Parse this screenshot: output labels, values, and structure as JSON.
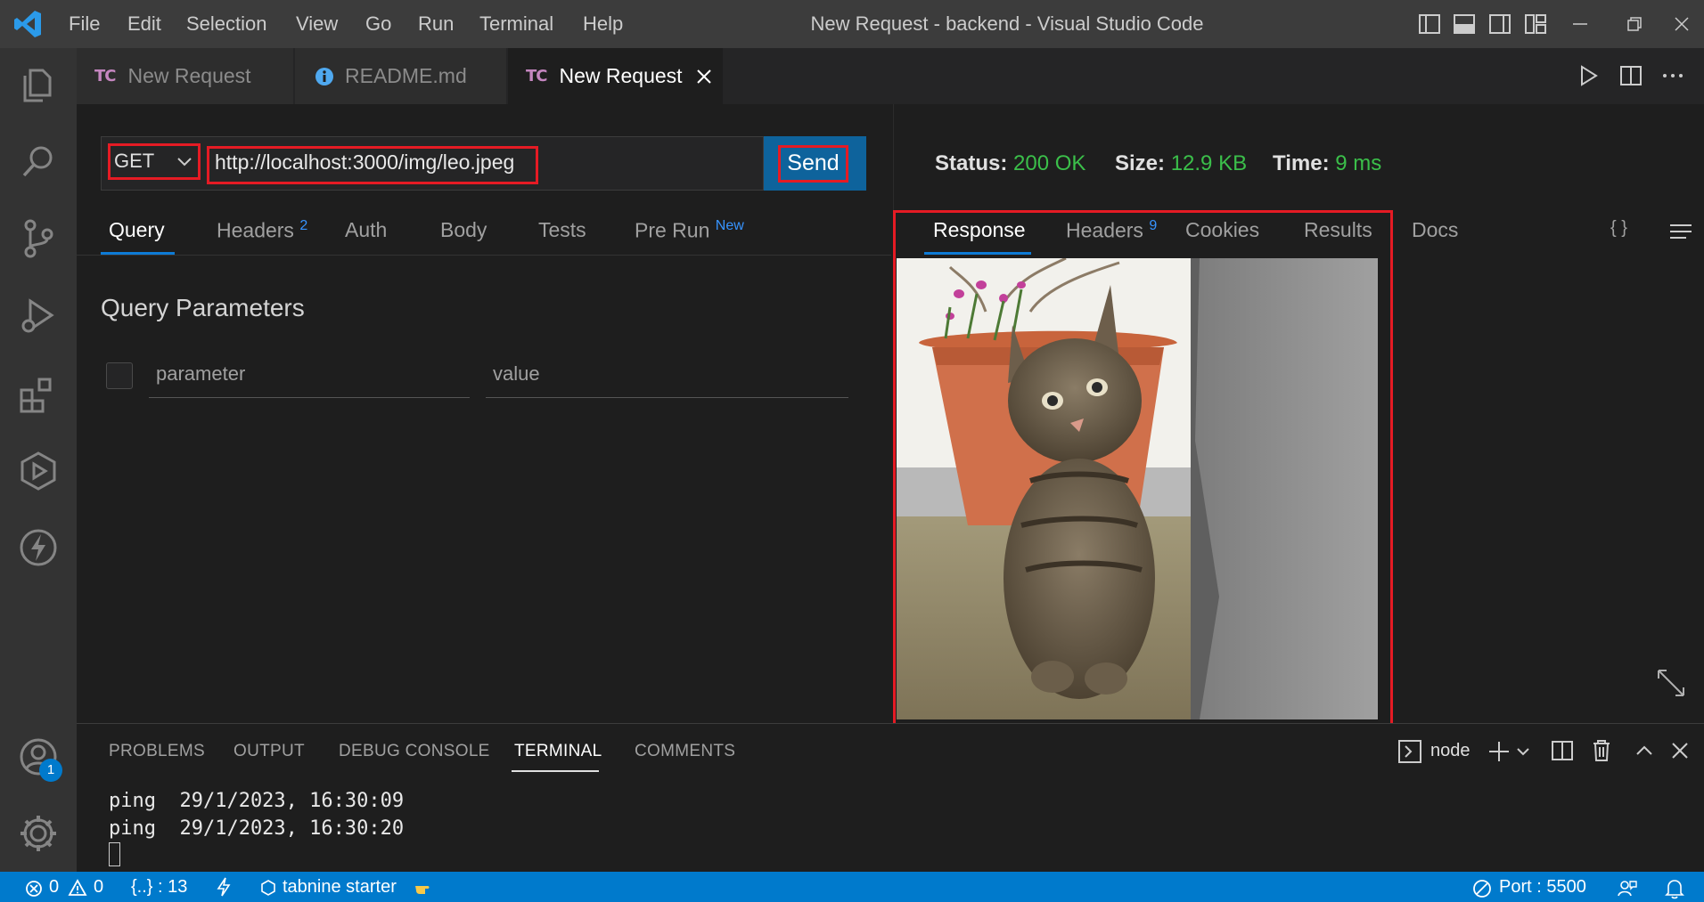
{
  "window": {
    "title": "New Request - backend - Visual Studio Code",
    "menu": [
      "File",
      "Edit",
      "Selection",
      "View",
      "Go",
      "Run",
      "Terminal",
      "Help"
    ]
  },
  "tabs": [
    {
      "badge": "TC",
      "label": "New Request",
      "active": false
    },
    {
      "badge": "",
      "label": "README.md",
      "active": false,
      "icon": "info-icon"
    },
    {
      "badge": "TC",
      "label": "New Request",
      "active": true,
      "icon": "close-icon"
    }
  ],
  "request": {
    "method": "GET",
    "url": "http://localhost:3000/img/leo.jpeg",
    "send_label": "Send",
    "tabs": {
      "query": "Query",
      "headers": "Headers",
      "headers_count": "2",
      "auth": "Auth",
      "body": "Body",
      "tests": "Tests",
      "prerun": "Pre Run",
      "prerun_badge": "New"
    },
    "query_title": "Query Parameters",
    "param_placeholder": "parameter",
    "value_placeholder": "value"
  },
  "response": {
    "status_label": "Status:",
    "status_value": "200 OK",
    "size_label": "Size:",
    "size_value": "12.9 KB",
    "time_label": "Time:",
    "time_value": "9 ms",
    "tabs": {
      "response": "Response",
      "headers": "Headers",
      "headers_count": "9",
      "cookies": "Cookies",
      "results": "Results",
      "docs": "Docs"
    },
    "braces": "{ }"
  },
  "panel": {
    "tabs": [
      "PROBLEMS",
      "OUTPUT",
      "DEBUG CONSOLE",
      "TERMINAL",
      "COMMENTS"
    ],
    "terminal_name": "node",
    "lines": [
      "ping  29/1/2023, 16:30:09",
      "ping  29/1/2023, 16:30:20"
    ]
  },
  "activity": {
    "accounts_badge": "1"
  },
  "statusbar": {
    "errors": "0",
    "warnings": "0",
    "json_scope": "{..} : 13",
    "tabnine": "tabnine starter",
    "port": "Port : 5500"
  },
  "colors": {
    "accent": "#007acc",
    "send_button": "#0e639c",
    "status_ok": "#3bbf4a",
    "highlight": "#e51b24"
  }
}
